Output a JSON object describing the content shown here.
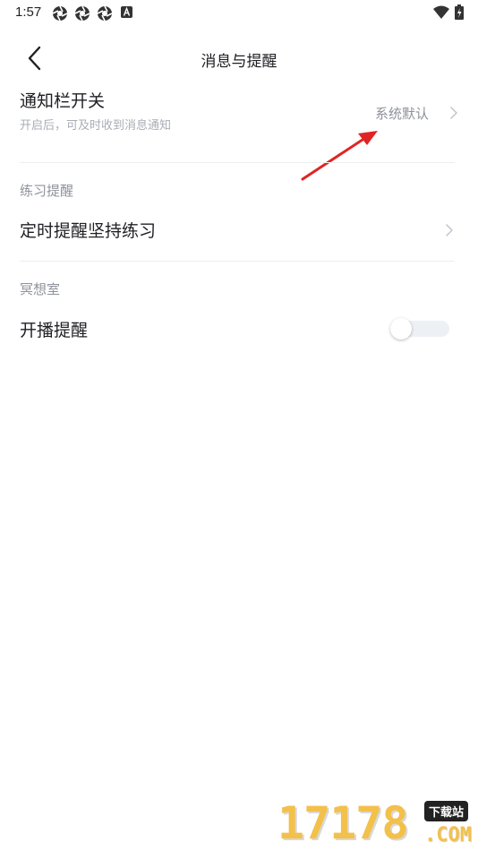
{
  "status_bar": {
    "time": "1:57",
    "left_icons": [
      "aperture-icon",
      "aperture-icon",
      "aperture-icon",
      "a-icon"
    ],
    "right_icons": [
      "wifi-icon",
      "battery-icon"
    ]
  },
  "nav": {
    "title": "消息与提醒",
    "back_icon": "chevron-left-icon"
  },
  "notification_bar": {
    "title": "通知栏开关",
    "subtitle": "开启后，可及时收到消息通知",
    "value": "系统默认"
  },
  "practice_section": {
    "header": "练习提醒",
    "item_label": "定时提醒坚持练习"
  },
  "meditation_section": {
    "header": "冥想室",
    "item_label": "开播提醒",
    "toggle_on": false
  },
  "annotation": {
    "arrow_color": "#e02424"
  },
  "watermark": {
    "digits": "17178",
    "tag": "下载站",
    "suffix": ".COM"
  },
  "colors": {
    "primary_text": "#1f1f24",
    "secondary_text": "#8e929b",
    "hint_text": "#a9adb6",
    "divider": "#eceef1",
    "toggle_track": "#edf0f4"
  }
}
